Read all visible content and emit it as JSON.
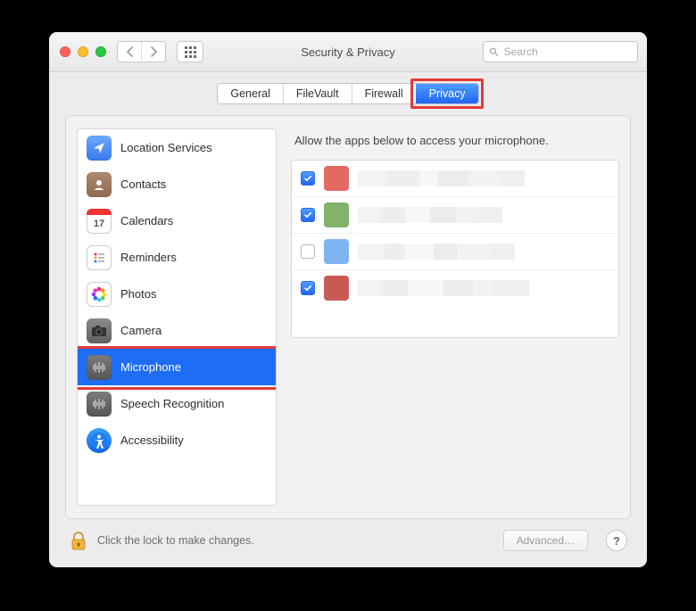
{
  "window": {
    "title": "Security & Privacy"
  },
  "search": {
    "placeholder": "Search"
  },
  "tabs": {
    "items": [
      {
        "label": "General"
      },
      {
        "label": "FileVault"
      },
      {
        "label": "Firewall"
      },
      {
        "label": "Privacy"
      }
    ],
    "active_index": 3,
    "highlighted_index": 3
  },
  "sidebar": {
    "items": [
      {
        "label": "Location Services",
        "icon": "location-arrow-icon"
      },
      {
        "label": "Contacts",
        "icon": "contacts-icon"
      },
      {
        "label": "Calendars",
        "icon": "calendar-icon",
        "calendar_day": "17"
      },
      {
        "label": "Reminders",
        "icon": "reminders-icon"
      },
      {
        "label": "Photos",
        "icon": "photos-icon"
      },
      {
        "label": "Camera",
        "icon": "camera-icon"
      },
      {
        "label": "Microphone",
        "icon": "microphone-icon"
      },
      {
        "label": "Speech Recognition",
        "icon": "speech-icon"
      },
      {
        "label": "Accessibility",
        "icon": "accessibility-icon"
      }
    ],
    "selected_index": 6,
    "highlighted_index": 6
  },
  "content": {
    "header": "Allow the apps below to access your microphone.",
    "apps": [
      {
        "checked": true,
        "icon_color": "#e36a62"
      },
      {
        "checked": true,
        "icon_color": "#81b36b"
      },
      {
        "checked": false,
        "icon_color": "#7eb4ef"
      },
      {
        "checked": true,
        "icon_color": "#c95a53"
      }
    ]
  },
  "footer": {
    "lock_hint": "Click the lock to make changes.",
    "advanced_label": "Advanced…",
    "help_label": "?"
  },
  "colors": {
    "accent": "#2166f3",
    "highlight_border": "#e53935"
  }
}
